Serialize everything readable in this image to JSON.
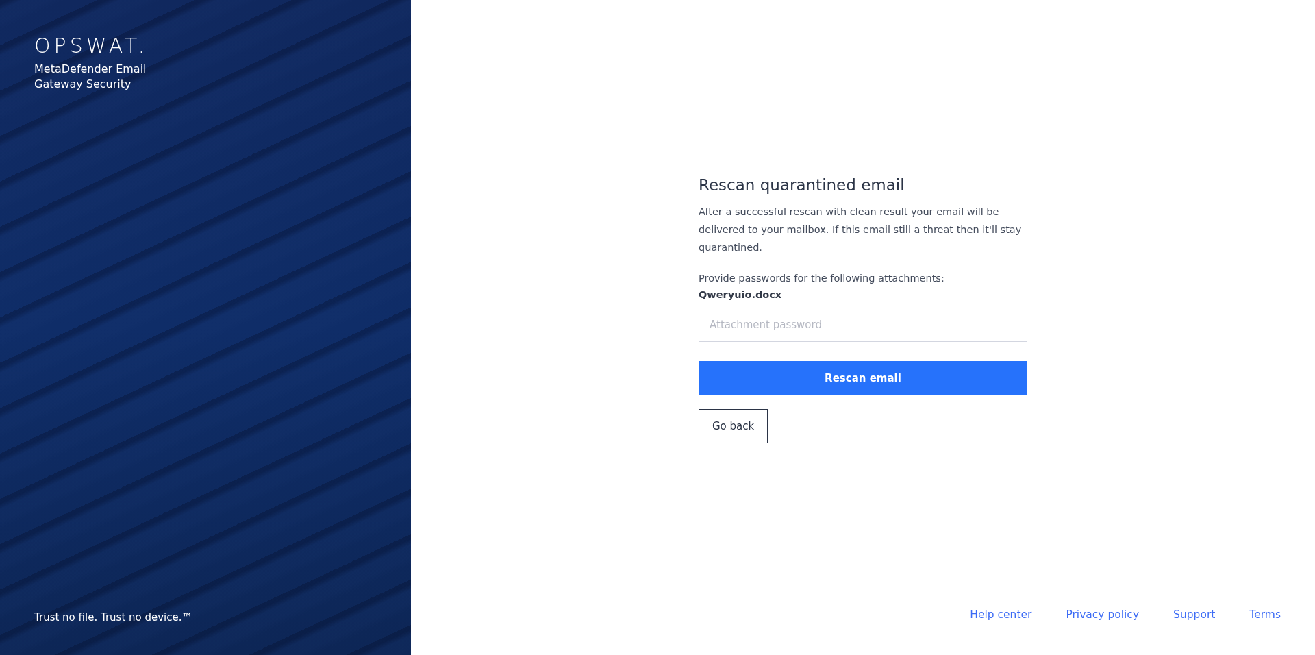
{
  "brand": {
    "logo": "OPSWAT.",
    "product": "MetaDefender Email Gateway Security",
    "tagline": "Trust no file. Trust no device.™"
  },
  "form": {
    "title": "Rescan quarantined email",
    "description": "After a successful rescan with clean result your email will be delivered to your mailbox. If this email still a threat then it'll stay quarantined.",
    "prompt": "Provide passwords for the following attachments:",
    "attachments": [
      {
        "name": "Qweryuio.docx",
        "placeholder": "Attachment password"
      }
    ],
    "primary_button": "Rescan email",
    "secondary_button": "Go back"
  },
  "footer_links": [
    "Help center",
    "Privacy policy",
    "Support",
    "Terms"
  ]
}
